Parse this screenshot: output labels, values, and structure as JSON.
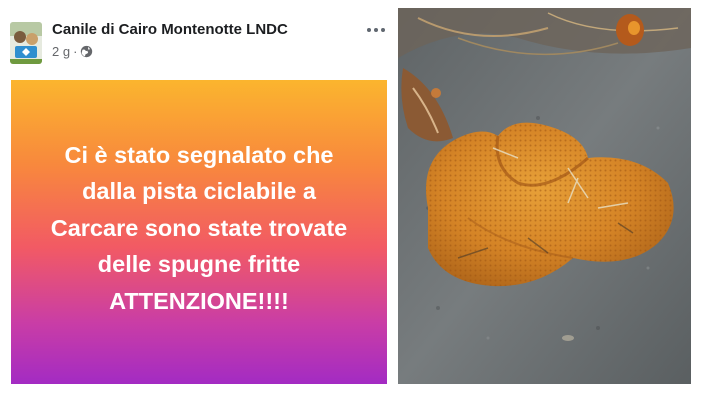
{
  "post": {
    "page_name": "Canile di Cairo Montenotte LNDC",
    "time": "2 g",
    "separator": "·",
    "audience_icon": "globe-icon",
    "more_icon": "more-options-icon",
    "text_lines": [
      "Ci è stato segnalato che",
      "dalla pista ciclabile a",
      "Carcare sono state trovate",
      "delle spugne fritte",
      "ATTENZIONE!!!!"
    ],
    "gradient_colors": [
      "#fbb52e",
      "#f8883d",
      "#f25a64",
      "#c93da6",
      "#a32bc3"
    ]
  },
  "photo": {
    "subject": "fried-sponge-on-ground",
    "colors": {
      "sponge": "#d98a2a",
      "ground": "#6c7274"
    }
  }
}
